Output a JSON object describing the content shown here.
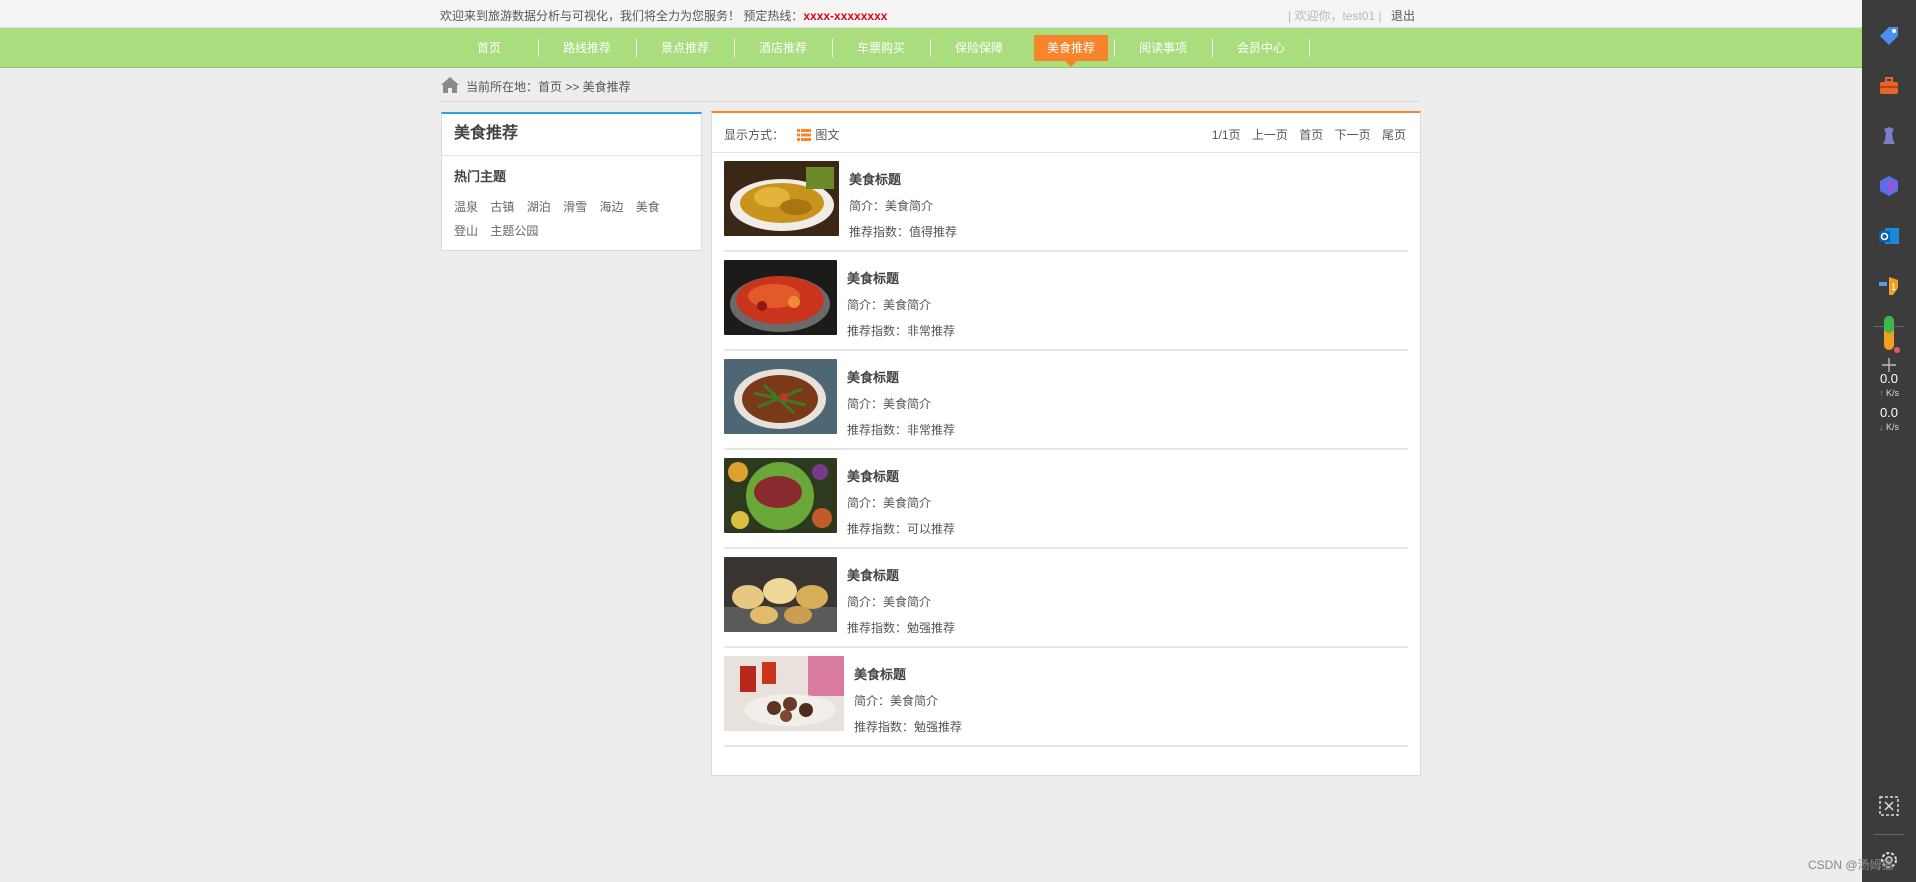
{
  "topbar": {
    "welcome": "欢迎来到旅游数据分析与可视化，我们将全力为您服务！ 预定热线：",
    "hotline": "xxxx-xxxxxxxx",
    "greeting": "| 欢迎你，test01 |",
    "logout": "退出"
  },
  "nav": {
    "items": [
      {
        "label": "首页"
      },
      {
        "label": "路线推荐"
      },
      {
        "label": "景点推荐"
      },
      {
        "label": "酒店推荐"
      },
      {
        "label": "车票购买"
      },
      {
        "label": "保险保障"
      },
      {
        "label": "美食推荐"
      },
      {
        "label": "阅读事项"
      },
      {
        "label": "会员中心"
      }
    ],
    "active_index": 6
  },
  "breadcrumb": {
    "text": "当前所在地：首页 >> 美食推荐"
  },
  "left_panel": {
    "title": "美食推荐",
    "subtitle": "热门主题",
    "tags": [
      "温泉",
      "古镇",
      "湖泊",
      "滑雪",
      "海边",
      "美食",
      "登山",
      "主题公园"
    ]
  },
  "right_panel": {
    "mode_label": "显示方式：",
    "mode_value": "图文",
    "pager": {
      "info": "1/1页",
      "prev": "上一页",
      "first": "首页",
      "next": "下一页",
      "last": "尾页"
    },
    "items": [
      {
        "title": "美食标题",
        "intro": "简介：美食简介",
        "rating": "推荐指数：值得推荐"
      },
      {
        "title": "美食标题",
        "intro": "简介：美食简介",
        "rating": "推荐指数：非常推荐"
      },
      {
        "title": "美食标题",
        "intro": "简介：美食简介",
        "rating": "推荐指数：非常推荐"
      },
      {
        "title": "美食标题",
        "intro": "简介：美食简介",
        "rating": "推荐指数：可以推荐"
      },
      {
        "title": "美食标题",
        "intro": "简介：美食简介",
        "rating": "推荐指数：勉强推荐"
      },
      {
        "title": "美食标题",
        "intro": "简介：美食简介",
        "rating": "推荐指数：勉强推荐"
      }
    ]
  },
  "sidebar": {
    "upload_speed": "0.0",
    "upload_unit": "K/s",
    "download_speed": "0.0",
    "download_unit": "K/s",
    "icons": [
      "tag-icon",
      "toolbox-icon",
      "chess-icon",
      "copilot-icon",
      "outlook-icon",
      "badge-icon",
      "meter-icon",
      "add-icon",
      "screenshot-icon",
      "settings-icon"
    ]
  },
  "watermark": "CSDN @汤姆猫",
  "colors": {
    "nav_bg": "#a9dd7e",
    "active": "#f6842a",
    "left_accent": "#29a3e8",
    "hotline": "#e2001a"
  }
}
